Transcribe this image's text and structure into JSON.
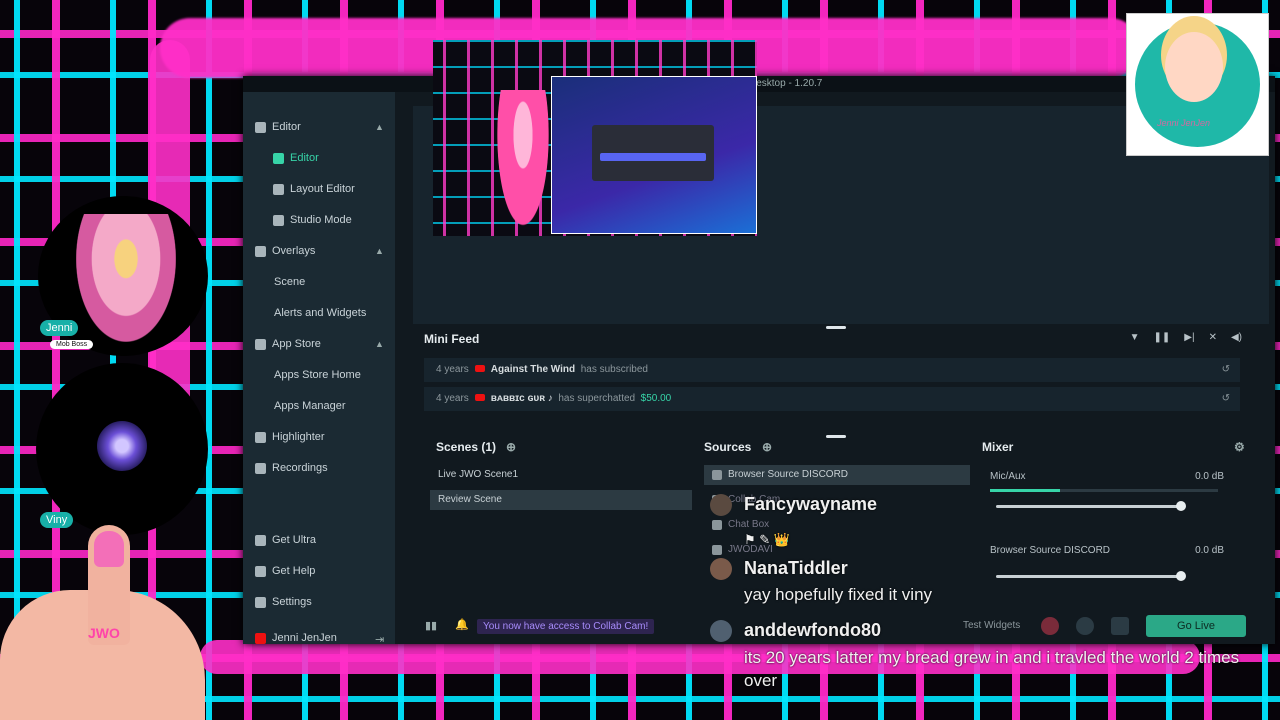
{
  "window": {
    "title": "Streamlabs Desktop - 1.20.7"
  },
  "sidebar": {
    "editor_group": "Editor",
    "items": [
      {
        "label": "Editor"
      },
      {
        "label": "Layout Editor"
      },
      {
        "label": "Studio Mode"
      }
    ],
    "overlays_group": "Overlays",
    "overlays_items": [
      {
        "label": "Scene"
      },
      {
        "label": "Alerts and Widgets"
      }
    ],
    "appstore_group": "App Store",
    "appstore_items": [
      {
        "label": "Apps Store Home"
      },
      {
        "label": "Apps Manager"
      }
    ],
    "highlighter": "Highlighter",
    "recordings": "Recordings",
    "get_ultra": "Get Ultra",
    "get_help": "Get Help",
    "settings": "Settings",
    "user": "Jenni JenJen"
  },
  "minifeed": {
    "title": "Mini Feed",
    "events": [
      {
        "age": "4 years",
        "name": "Against The Wind",
        "action": "has subscribed",
        "amount": ""
      },
      {
        "age": "4 years",
        "name": "ʙᴀʙʙɪᴄ ɢᴜʀ ♪",
        "action": "has superchatted",
        "amount": "$50.00"
      }
    ]
  },
  "scenes": {
    "title": "Scenes (1)",
    "items": [
      {
        "label": "Live JWO Scene1"
      },
      {
        "label": "Review Scene"
      }
    ]
  },
  "sources": {
    "title": "Sources",
    "items": [
      {
        "label": "Browser Source DISCORD"
      },
      {
        "label": "Collab Cam"
      },
      {
        "label": "Chat Box"
      },
      {
        "label": "JWODAVI"
      }
    ]
  },
  "mixer": {
    "title": "Mixer",
    "channels": [
      {
        "name": "Mic/Aux",
        "level": "0.0 dB"
      },
      {
        "name": "Browser Source DISCORD",
        "level": "0.0 dB"
      }
    ]
  },
  "footer": {
    "notice": "You now have access to Collab Cam!",
    "test_widgets": "Test Widgets",
    "go_live": "Go Live"
  },
  "overlay": {
    "cam1_name": "Jenni",
    "cam1_role": "Mob Boss",
    "cam2_name": "Viny",
    "logo_signature": "Jenni JenJen",
    "hand_ring": "JWO"
  },
  "chat": {
    "messages": [
      {
        "user": "Fancywayname",
        "text": ""
      },
      {
        "user": "NanaTiddler",
        "text": "yay hopefully fixed it viny"
      },
      {
        "user": "anddewfondo80",
        "text": "its 20 years latter my bread grew in and i travled the world 2 times over"
      }
    ]
  },
  "colors": {
    "accent": "#37d4a8",
    "pink": "#ff2fc8",
    "cyan": "#00e6ff"
  }
}
